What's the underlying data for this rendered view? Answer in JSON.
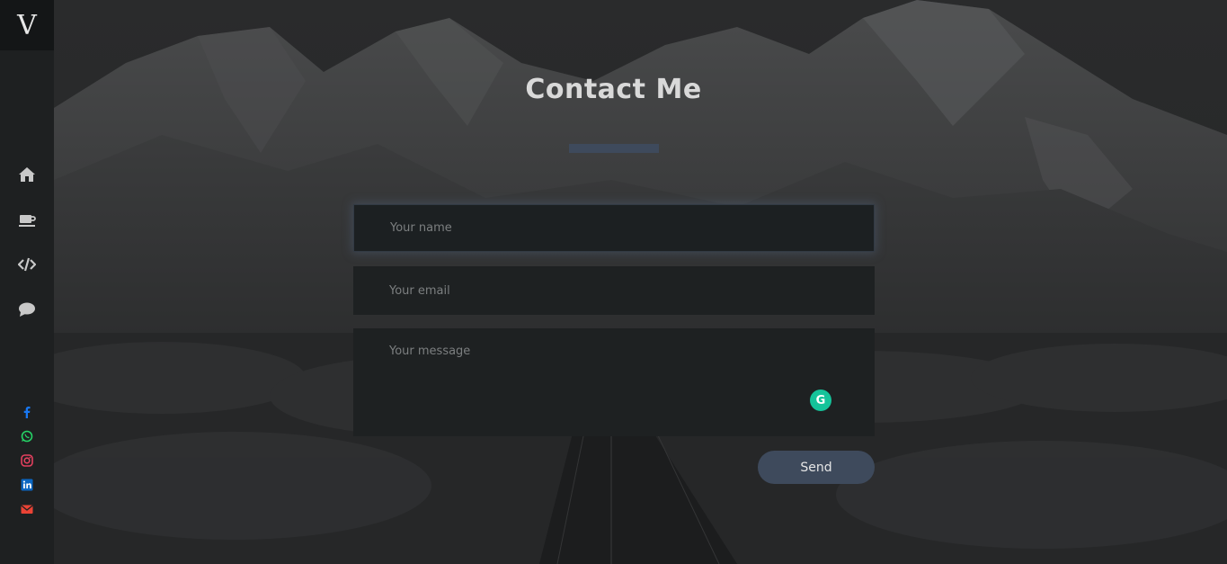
{
  "sidebar": {
    "logo": "V",
    "nav_icons": [
      "home-icon",
      "coffee-icon",
      "code-icon",
      "comment-icon"
    ],
    "social_icons": [
      "facebook-icon",
      "whatsapp-icon",
      "instagram-icon",
      "linkedin-icon",
      "mail-icon"
    ]
  },
  "main": {
    "title": "Contact Me",
    "form": {
      "name_placeholder": "Your name",
      "email_placeholder": "Your email",
      "message_placeholder": "Your message",
      "send_label": "Send"
    },
    "grammarly_letter": "G"
  },
  "colors": {
    "accent": "#3e4a5c",
    "facebook": "#1877f2",
    "whatsapp": "#25d366",
    "instagram": "#e4405f",
    "linkedin": "#0a66c2",
    "mail": "#ea4335",
    "grammarly": "#15c39a"
  }
}
